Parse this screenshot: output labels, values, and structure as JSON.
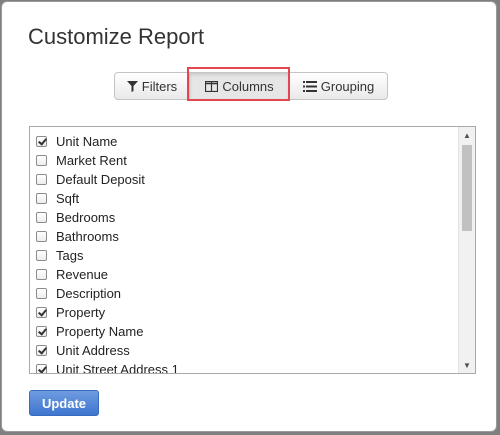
{
  "dialog": {
    "title": "Customize Report"
  },
  "tabs": [
    {
      "label": "Filters",
      "icon": "filter-icon"
    },
    {
      "label": "Columns",
      "icon": "columns-icon",
      "active": true
    },
    {
      "label": "Grouping",
      "icon": "list-icon"
    }
  ],
  "columns_list": [
    {
      "label": "Unit Name",
      "checked": true
    },
    {
      "label": "Market Rent",
      "checked": false
    },
    {
      "label": "Default Deposit",
      "checked": false
    },
    {
      "label": "Sqft",
      "checked": false
    },
    {
      "label": "Bedrooms",
      "checked": false
    },
    {
      "label": "Bathrooms",
      "checked": false
    },
    {
      "label": "Tags",
      "checked": false
    },
    {
      "label": "Revenue",
      "checked": false
    },
    {
      "label": "Description",
      "checked": false
    },
    {
      "label": "Property",
      "checked": true
    },
    {
      "label": "Property Name",
      "checked": true
    },
    {
      "label": "Unit Address",
      "checked": true
    },
    {
      "label": "Unit Street Address 1",
      "checked": true
    }
  ],
  "update_button": {
    "label": "Update"
  },
  "colors": {
    "highlight": "#e2474f",
    "primary": "#4a7fd4"
  }
}
